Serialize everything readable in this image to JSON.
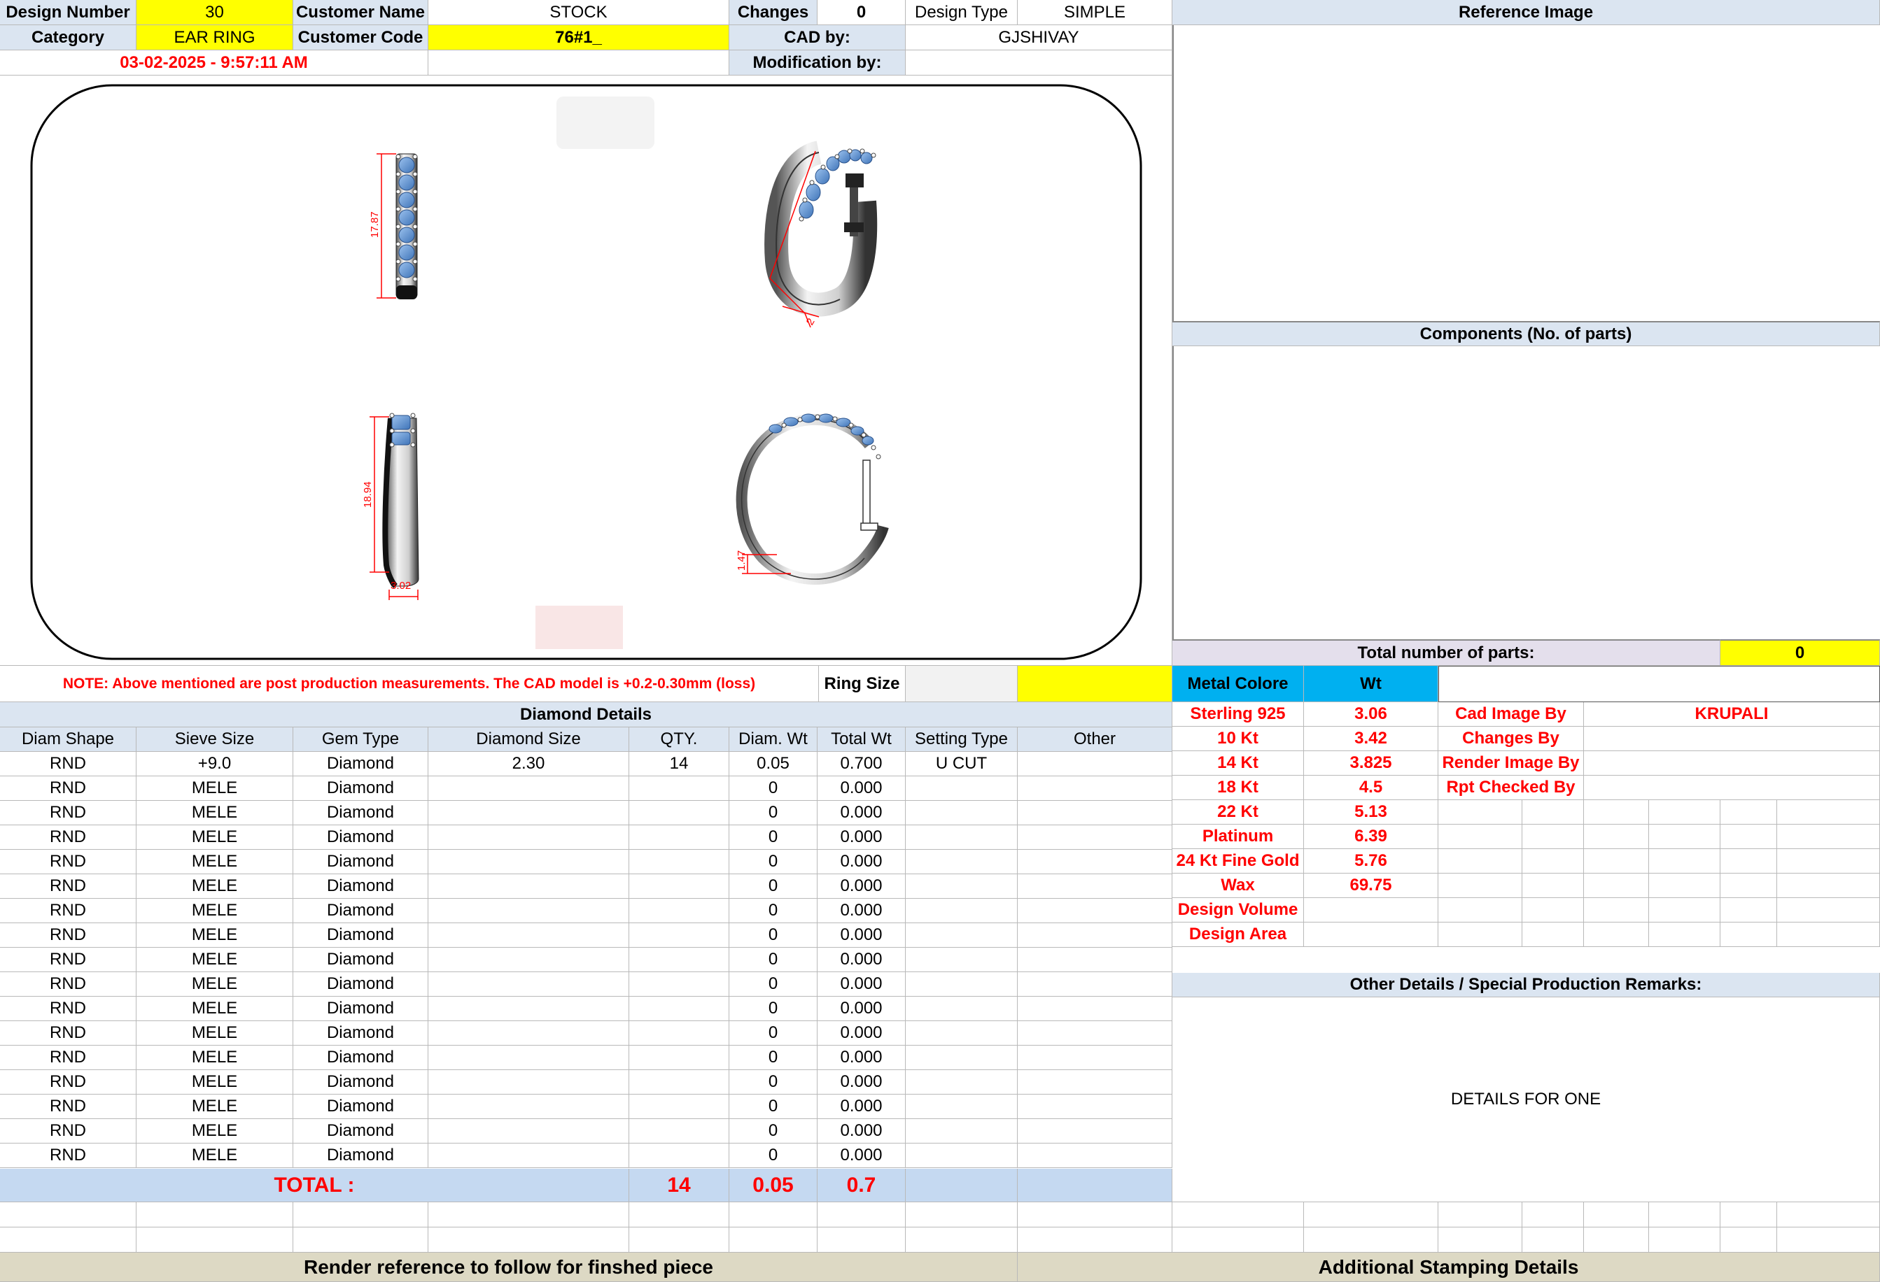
{
  "header": {
    "design_number_label": "Design Number",
    "design_number": "30",
    "customer_name_label": "Customer Name",
    "customer_name": "STOCK",
    "changes_label": "Changes",
    "changes": "0",
    "design_type_label": "Design Type",
    "design_type": "SIMPLE",
    "category_label": "Category",
    "category": "EAR RING",
    "customer_code_label": "Customer Code",
    "customer_code": "76#1_",
    "cad_by_label": "CAD by:",
    "cad_by": "GJSHIVAY",
    "timestamp": "03-02-2025 - 9:57:11 AM",
    "modification_by_label": "Modification by:",
    "modification_by": ""
  },
  "cad_views": {
    "dim_height_front": "17.87",
    "dim_height_side": "18.94",
    "dim_width_side": "3.02",
    "dim_thickness": "1.47",
    "dim_perspective": "2"
  },
  "right_panel": {
    "reference_image_title": "Reference Image",
    "components_title": "Components (No. of parts)",
    "total_parts_label": "Total number of parts:",
    "total_parts": "0"
  },
  "note": {
    "text": "NOTE: Above mentioned are post production measurements. The CAD model is +0.2-0.30mm (loss)",
    "ring_size_label": "Ring Size",
    "ring_size": ""
  },
  "diamond": {
    "title": "Diamond Details",
    "columns": [
      "Diam Shape",
      "Sieve Size",
      "Gem Type",
      "Diamond Size",
      "QTY.",
      "Diam. Wt",
      "Total Wt",
      "Setting Type",
      "Other"
    ],
    "rows": [
      [
        "RND",
        "+9.0",
        "Diamond",
        "2.30",
        "14",
        "0.05",
        "0.700",
        "U CUT",
        ""
      ],
      [
        "RND",
        "MELE",
        "Diamond",
        "",
        "",
        "0",
        "0.000",
        "",
        ""
      ],
      [
        "RND",
        "MELE",
        "Diamond",
        "",
        "",
        "0",
        "0.000",
        "",
        ""
      ],
      [
        "RND",
        "MELE",
        "Diamond",
        "",
        "",
        "0",
        "0.000",
        "",
        ""
      ],
      [
        "RND",
        "MELE",
        "Diamond",
        "",
        "",
        "0",
        "0.000",
        "",
        ""
      ],
      [
        "RND",
        "MELE",
        "Diamond",
        "",
        "",
        "0",
        "0.000",
        "",
        ""
      ],
      [
        "RND",
        "MELE",
        "Diamond",
        "",
        "",
        "0",
        "0.000",
        "",
        ""
      ],
      [
        "RND",
        "MELE",
        "Diamond",
        "",
        "",
        "0",
        "0.000",
        "",
        ""
      ],
      [
        "RND",
        "MELE",
        "Diamond",
        "",
        "",
        "0",
        "0.000",
        "",
        ""
      ],
      [
        "RND",
        "MELE",
        "Diamond",
        "",
        "",
        "0",
        "0.000",
        "",
        ""
      ],
      [
        "RND",
        "MELE",
        "Diamond",
        "",
        "",
        "0",
        "0.000",
        "",
        ""
      ],
      [
        "RND",
        "MELE",
        "Diamond",
        "",
        "",
        "0",
        "0.000",
        "",
        ""
      ],
      [
        "RND",
        "MELE",
        "Diamond",
        "",
        "",
        "0",
        "0.000",
        "",
        ""
      ],
      [
        "RND",
        "MELE",
        "Diamond",
        "",
        "",
        "0",
        "0.000",
        "",
        ""
      ],
      [
        "RND",
        "MELE",
        "Diamond",
        "",
        "",
        "0",
        "0.000",
        "",
        ""
      ],
      [
        "RND",
        "MELE",
        "Diamond",
        "",
        "",
        "0",
        "0.000",
        "",
        ""
      ],
      [
        "RND",
        "MELE",
        "Diamond",
        "",
        "",
        "0",
        "0.000",
        "",
        ""
      ]
    ],
    "total_label": "TOTAL :",
    "total_qty": "14",
    "total_diam_wt": "0.05",
    "total_wt": "0.7"
  },
  "metal": {
    "header_label": "Metal Colore",
    "header_wt": "Wt",
    "rows": [
      [
        "Sterling 925",
        "3.06"
      ],
      [
        "10 Kt",
        "3.42"
      ],
      [
        "14 Kt",
        "3.825"
      ],
      [
        "18 Kt",
        "4.5"
      ],
      [
        "22 Kt",
        "5.13"
      ],
      [
        "Platinum",
        "6.39"
      ],
      [
        "24 Kt Fine Gold",
        "5.76"
      ],
      [
        "Wax",
        "69.75"
      ],
      [
        "Design Volume",
        ""
      ],
      [
        "Design Area",
        ""
      ]
    ]
  },
  "credits": {
    "rows": [
      [
        "Cad Image By",
        "KRUPALI"
      ],
      [
        "Changes By",
        ""
      ],
      [
        "Render Image By",
        ""
      ],
      [
        "Rpt Checked By",
        ""
      ]
    ]
  },
  "remarks": {
    "title": "Other Details / Special Production Remarks:",
    "text": "DETAILS  FOR ONE"
  },
  "footer": {
    "render_reference": "Render reference to follow for finshed piece",
    "stamping": "Additional Stamping Details"
  },
  "colors": {
    "label_bg": "#dbe5f1",
    "highlight": "#ffff00",
    "accent_red": "#ff0000",
    "metal_header": "#00b0f0",
    "total_bg": "#c5d9f1",
    "footer_bg": "#ddd9c4",
    "gem_blue": "#6f9fd6"
  }
}
